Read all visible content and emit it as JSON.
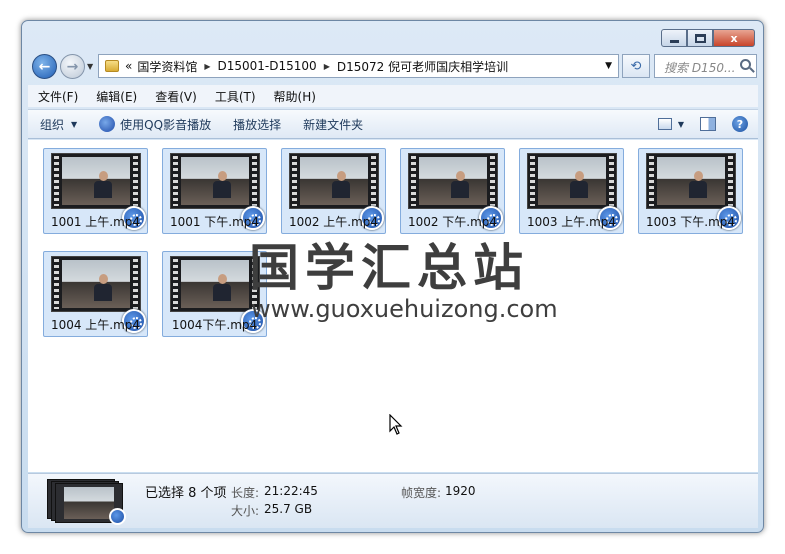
{
  "window": {
    "caption": {
      "minimize": "minimize",
      "maximize": "maximize",
      "close": "x"
    }
  },
  "navigation": {
    "back_glyph": "←",
    "forward_glyph": "→",
    "address": {
      "chevron": "«",
      "crumbs": [
        "国学资料馆",
        "D15001-D15100",
        "D15072 倪可老师国庆相学培训"
      ]
    },
    "search_placeholder": "搜索 D150..."
  },
  "menu": {
    "items": [
      "文件(F)",
      "编辑(E)",
      "查看(V)",
      "工具(T)",
      "帮助(H)"
    ]
  },
  "toolbar": {
    "organize": "组织",
    "play_qq": "使用QQ影音播放",
    "play_selection": "播放选择",
    "new_folder": "新建文件夹"
  },
  "files": [
    {
      "name": "1001 上午.mp4"
    },
    {
      "name": "1001 下午.mp4"
    },
    {
      "name": "1002 上午.mp4"
    },
    {
      "name": "1002 下午.mp4"
    },
    {
      "name": "1003 上午.mp4"
    },
    {
      "name": "1003 下午.mp4"
    },
    {
      "name": "1004 上午.mp4"
    },
    {
      "name": "1004下午.mp4"
    }
  ],
  "watermark": {
    "title": "国学汇总站",
    "url": "www.guoxuehuizong.com"
  },
  "details": {
    "selected": "已选择 8 个项",
    "length_label": "长度:",
    "length_value": "21:22:45",
    "size_label": "大小:",
    "size_value": "25.7 GB",
    "framewidth_label": "帧宽度:",
    "framewidth_value": "1920"
  },
  "colors": {
    "selection": "#d7e7f9",
    "selection_border": "#84acdd",
    "window_frame": "#c8dcef",
    "close_button": "#c8442a"
  }
}
